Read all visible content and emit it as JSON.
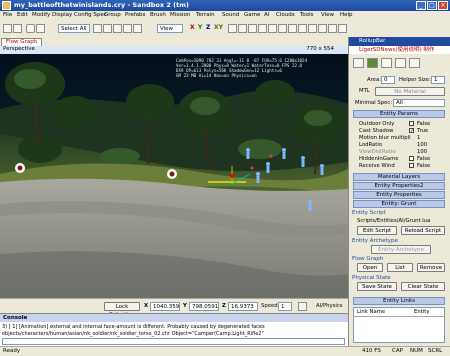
{
  "window": {
    "title": "my_battleofthetwinislands.cry - Sandbox 2 (tm)",
    "min": "_",
    "max": "□",
    "close": "✕"
  },
  "menu": [
    "File",
    "Edit",
    "Modify",
    "Display",
    "Config Spec",
    "Group",
    "Prefabs",
    "Brush",
    "Mission",
    "Terrain",
    "Sound",
    "Game",
    "AI",
    "Clouds",
    "Tools",
    "View",
    "Help"
  ],
  "toolbar": {
    "select_filter": "Select All",
    "view_mode": "View",
    "axes": [
      "X",
      "Y",
      "Z",
      "XY"
    ],
    "tool_label": "Terrain"
  },
  "tabs": {
    "flow_graph": "Flow Graph"
  },
  "viewport": {
    "name": "Perspective",
    "resolution": "770 x 554",
    "overlay_lines": [
      "CamPos=1090 782 31 Angl=-11 0 -87 FOV=75.6 1280x1024",
      "Ver=1.4.1.2008 Phys=8 Water=1 WaterTess=0 FPS 22.0",
      "DX9 DP=613 Polys=56K ShadowGen=12 Lights=6",
      "GM 23 MB Ai=14 Nav=on Physics=on"
    ]
  },
  "lockbar": {
    "lock_selection": "Lock Selection",
    "x_value": "1040.359",
    "y_value": "798.0591",
    "z_value": "16.9373",
    "speed_label": "Speed:",
    "speed_value": "1",
    "ai_physics": "AI/Physics"
  },
  "console": {
    "title": "Console",
    "lines": [
      "3) [ 1]  [Animation]    external and internal face-amount is different. Probably caused by degenerated faces",
      "objects/characters/human/asian/nk_soldier/nk_soldier_torso_02.chr  Object=\"Camper(Camp.Light_Rifle2\""
    ]
  },
  "status": {
    "left": "Ready",
    "fps": "410 FS",
    "cap": "CAP",
    "num": "NUM",
    "scrl": "SCRL"
  },
  "rollup": {
    "title": "RollupBar",
    "subtitle": "LigerSDNews(使用说明) 制作",
    "area_label": "Area:",
    "area_value": "0",
    "helper_size_label": "Helper Size:",
    "helper_size_value": "1",
    "mtl_label": "MTL",
    "mtl_value": "No Material",
    "minspec_label": "Minimal Spec:",
    "minspec_value": "All",
    "entity_params_title": "Entity Params",
    "params": [
      {
        "name": "Outdoor Only",
        "value": "False",
        "check": false
      },
      {
        "name": "Cast Shadow",
        "value": "True",
        "check": true
      },
      {
        "name": "Motion blur multipli",
        "value": "1",
        "check": null
      },
      {
        "name": "LodRatio",
        "value": "100",
        "check": null
      },
      {
        "name": "ViewDistRatio",
        "value": "100",
        "check": null
      },
      {
        "name": "HiddenInGame",
        "value": "False",
        "check": false
      },
      {
        "name": "Receive Wind",
        "value": "False",
        "check": false
      }
    ],
    "material_layers": "Material Layers",
    "entity_properties2": "Entity Properties2",
    "entity_properties": "Entity Properties",
    "entity_grunt": "Entity: Grunt",
    "entity_script_title": "Entity Script",
    "script_path": "Scripts/Entities/AI/Grunt.lua",
    "edit_script": "Edit Script",
    "reload_script": "Reload Script",
    "entity_archetype_title": "Entity Archetype",
    "entity_archetype_btn": "Entity Archetype",
    "flow_graph_title": "Flow Graph",
    "fg_open": "Open",
    "fg_list": "List",
    "fg_remove": "Remove",
    "physical_state_title": "Physical State",
    "save_state": "Save State",
    "clear_state": "Clear State",
    "entity_links_title": "Entity Links",
    "link_col_name": "Link Name",
    "link_col_entity": "Entity"
  },
  "colors": {
    "title_bar": "#1f4aa0",
    "panel": "#ece9d8",
    "section": "#b9c9ea",
    "accent_red": "#c00000"
  }
}
